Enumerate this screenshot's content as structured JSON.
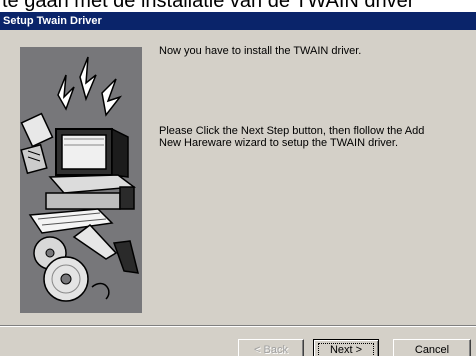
{
  "background_caption": "te gaan met de installatie van de TWAIN driver",
  "window": {
    "title": "Setup Twain Driver"
  },
  "content": {
    "line1": "Now you have to install the TWAIN driver.",
    "line2a": "Please Click the Next Step button, then flollow the Add",
    "line2b": "New Hareware wizard to setup the TWAIN driver."
  },
  "buttons": {
    "back": "< Back",
    "next": "Next >",
    "cancel": "Cancel"
  },
  "colors": {
    "titlebar": "#0a246a",
    "face": "#d4d0c8",
    "image_panel": "#77777a"
  },
  "icons": {
    "illustration": "computer-scanner-cd-illustration"
  }
}
